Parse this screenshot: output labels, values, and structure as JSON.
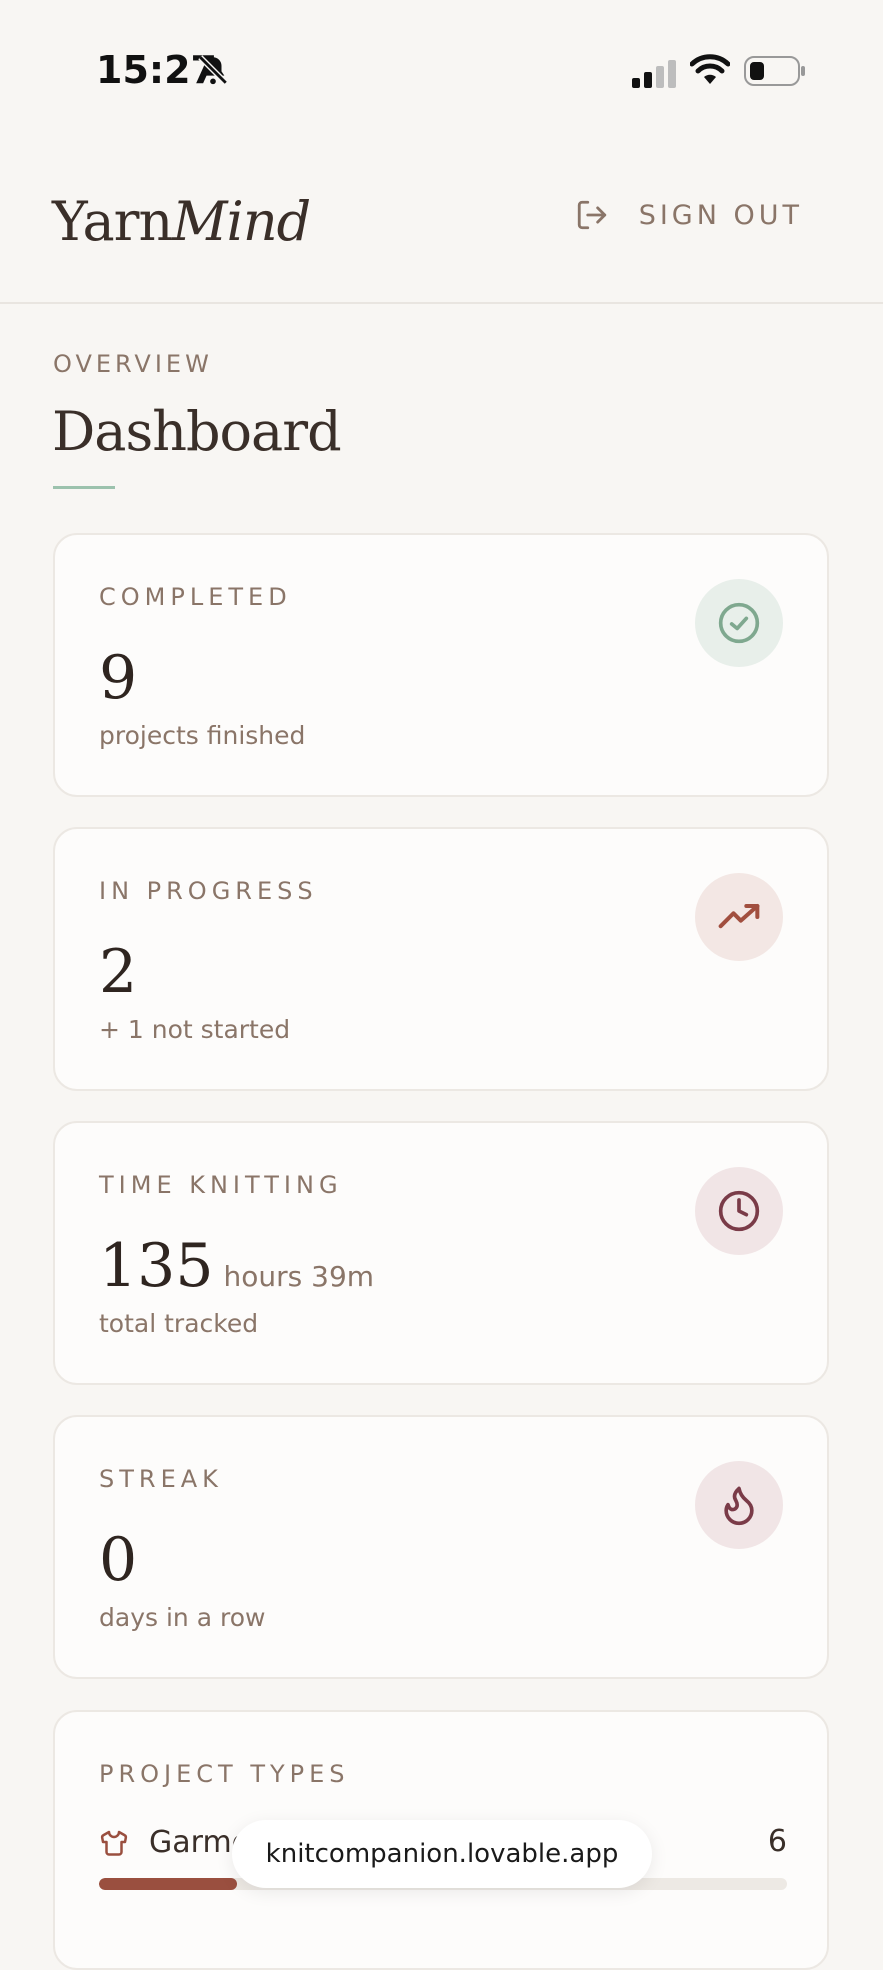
{
  "status_bar": {
    "time": "15:27"
  },
  "header": {
    "logo_part1": "Yarn",
    "logo_part2": "Mind",
    "sign_out_label": "SIGN OUT"
  },
  "page": {
    "eyebrow": "OVERVIEW",
    "title": "Dashboard"
  },
  "stats": [
    {
      "label": "COMPLETED",
      "value": "9",
      "unit": "",
      "sub": "projects finished",
      "icon": "check-circle-icon",
      "icon_bg": "#e8efea",
      "icon_color": "#7fa88f"
    },
    {
      "label": "IN PROGRESS",
      "value": "2",
      "unit": "",
      "sub": "+ 1 not started",
      "icon": "trending-up-icon",
      "icon_bg": "#f3e7e4",
      "icon_color": "#a14f3f"
    },
    {
      "label": "TIME KNITTING",
      "value": "135",
      "unit": "hours 39m",
      "sub": "total tracked",
      "icon": "clock-icon",
      "icon_bg": "#f1e5e6",
      "icon_color": "#7a3b48"
    },
    {
      "label": "STREAK",
      "value": "0",
      "unit": "",
      "sub": "days in a row",
      "icon": "flame-icon",
      "icon_bg": "#f1e5e6",
      "icon_color": "#7a3b48"
    }
  ],
  "project_types": {
    "label": "PROJECT TYPES",
    "items": [
      {
        "name": "Garment",
        "count": "6",
        "share": 0.2,
        "icon": "shirt-icon"
      }
    ]
  },
  "browser": {
    "url": "knitcompanion.lovable.app"
  },
  "colors": {
    "background": "#f8f6f3",
    "accent_sage": "#9cc2ad",
    "accent_rust": "#9a4f3f",
    "text_muted": "#8a7568"
  }
}
